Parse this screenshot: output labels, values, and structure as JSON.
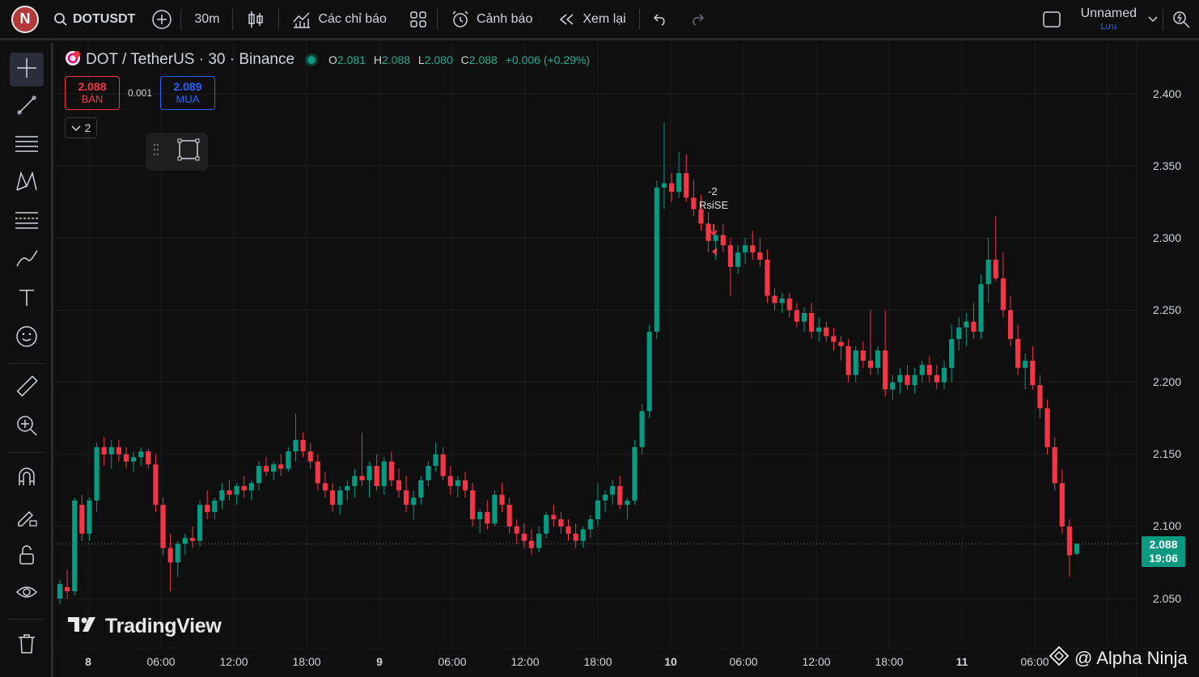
{
  "toolbar": {
    "avatar": "N",
    "symbol": "DOTUSDT",
    "interval": "30m",
    "indicators": "Các chỉ báo",
    "alerts": "Cảnh báo",
    "replay": "Xem lại",
    "layout_name": "Unnamed",
    "save": "Lưu"
  },
  "legend": {
    "title": "DOT / TetherUS · 30 · Binance",
    "o_key": "O",
    "o": "2.081",
    "h_key": "H",
    "h": "2.088",
    "l_key": "L",
    "l": "2.080",
    "c_key": "C",
    "c": "2.088",
    "change": "+0.006 (+0.29%)"
  },
  "trade": {
    "sell_price": "2.088",
    "sell_label": "BÁN",
    "spread": "0.001",
    "buy_price": "2.089",
    "buy_label": "MUA",
    "collapse_count": "2"
  },
  "price_axis": [
    "2.400",
    "2.350",
    "2.300",
    "2.250",
    "2.200",
    "2.150",
    "2.100",
    "2.050"
  ],
  "time_axis": [
    "8",
    "06:00",
    "12:00",
    "18:00",
    "9",
    "06:00",
    "12:00",
    "18:00",
    "10",
    "06:00",
    "12:00",
    "18:00",
    "11",
    "06:00"
  ],
  "last_price": {
    "price": "2.088",
    "countdown": "19:06"
  },
  "annotation": {
    "qty": "-2",
    "label": "RsiSE"
  },
  "brand": "TradingView",
  "watermark": "@ Alpha Ninja",
  "colors": {
    "up": "#089981",
    "down": "#f23645",
    "background": "#0f0f0f",
    "accent": "#2962ff"
  },
  "chart_data": {
    "type": "candlestick",
    "symbol": "DOT / TetherUS",
    "interval": "30",
    "exchange": "Binance",
    "ylim": [
      2.05,
      2.4
    ],
    "candles": [
      [
        2.05,
        2.063,
        2.046,
        2.06
      ],
      [
        2.058,
        2.07,
        2.05,
        2.055
      ],
      [
        2.055,
        2.12,
        2.052,
        2.118
      ],
      [
        2.115,
        2.122,
        2.09,
        2.095
      ],
      [
        2.095,
        2.12,
        2.09,
        2.118
      ],
      [
        2.118,
        2.158,
        2.11,
        2.155
      ],
      [
        2.155,
        2.162,
        2.142,
        2.15
      ],
      [
        2.15,
        2.16,
        2.14,
        2.155
      ],
      [
        2.155,
        2.16,
        2.145,
        2.15
      ],
      [
        2.15,
        2.155,
        2.14,
        2.145
      ],
      [
        2.145,
        2.152,
        2.138,
        2.148
      ],
      [
        2.148,
        2.155,
        2.142,
        2.152
      ],
      [
        2.152,
        2.154,
        2.14,
        2.143
      ],
      [
        2.143,
        2.15,
        2.11,
        2.115
      ],
      [
        2.115,
        2.12,
        2.08,
        2.085
      ],
      [
        2.085,
        2.095,
        2.055,
        2.075
      ],
      [
        2.075,
        2.09,
        2.065,
        2.088
      ],
      [
        2.088,
        2.095,
        2.08,
        2.092
      ],
      [
        2.092,
        2.1,
        2.085,
        2.09
      ],
      [
        2.09,
        2.118,
        2.086,
        2.115
      ],
      [
        2.115,
        2.125,
        2.105,
        2.11
      ],
      [
        2.11,
        2.12,
        2.105,
        2.118
      ],
      [
        2.118,
        2.13,
        2.112,
        2.125
      ],
      [
        2.125,
        2.132,
        2.118,
        2.122
      ],
      [
        2.122,
        2.13,
        2.115,
        2.128
      ],
      [
        2.128,
        2.135,
        2.12,
        2.125
      ],
      [
        2.125,
        2.132,
        2.118,
        2.13
      ],
      [
        2.13,
        2.145,
        2.125,
        2.142
      ],
      [
        2.142,
        2.148,
        2.135,
        2.138
      ],
      [
        2.138,
        2.145,
        2.132,
        2.143
      ],
      [
        2.143,
        2.15,
        2.135,
        2.14
      ],
      [
        2.14,
        2.155,
        2.138,
        2.152
      ],
      [
        2.152,
        2.178,
        2.145,
        2.16
      ],
      [
        2.16,
        2.165,
        2.148,
        2.152
      ],
      [
        2.152,
        2.158,
        2.14,
        2.145
      ],
      [
        2.145,
        2.15,
        2.125,
        2.13
      ],
      [
        2.13,
        2.138,
        2.12,
        2.125
      ],
      [
        2.125,
        2.13,
        2.11,
        2.115
      ],
      [
        2.115,
        2.128,
        2.108,
        2.125
      ],
      [
        2.125,
        2.132,
        2.118,
        2.128
      ],
      [
        2.128,
        2.14,
        2.12,
        2.135
      ],
      [
        2.135,
        2.165,
        2.128,
        2.132
      ],
      [
        2.132,
        2.145,
        2.12,
        2.142
      ],
      [
        2.142,
        2.15,
        2.125,
        2.128
      ],
      [
        2.128,
        2.148,
        2.122,
        2.145
      ],
      [
        2.145,
        2.152,
        2.128,
        2.132
      ],
      [
        2.132,
        2.14,
        2.12,
        2.125
      ],
      [
        2.125,
        2.135,
        2.11,
        2.115
      ],
      [
        2.115,
        2.125,
        2.105,
        2.12
      ],
      [
        2.12,
        2.135,
        2.115,
        2.132
      ],
      [
        2.132,
        2.145,
        2.128,
        2.142
      ],
      [
        2.142,
        2.158,
        2.138,
        2.15
      ],
      [
        2.15,
        2.155,
        2.132,
        2.135
      ],
      [
        2.135,
        2.142,
        2.122,
        2.128
      ],
      [
        2.128,
        2.135,
        2.12,
        2.132
      ],
      [
        2.132,
        2.138,
        2.12,
        2.125
      ],
      [
        2.125,
        2.13,
        2.1,
        2.105
      ],
      [
        2.105,
        2.112,
        2.095,
        2.11
      ],
      [
        2.11,
        2.118,
        2.098,
        2.102
      ],
      [
        2.102,
        2.125,
        2.1,
        2.122
      ],
      [
        2.122,
        2.13,
        2.11,
        2.115
      ],
      [
        2.115,
        2.12,
        2.095,
        2.1
      ],
      [
        2.1,
        2.105,
        2.088,
        2.095
      ],
      [
        2.095,
        2.102,
        2.085,
        2.09
      ],
      [
        2.09,
        2.098,
        2.08,
        2.085
      ],
      [
        2.085,
        2.1,
        2.082,
        2.095
      ],
      [
        2.095,
        2.11,
        2.092,
        2.108
      ],
      [
        2.108,
        2.115,
        2.1,
        2.105
      ],
      [
        2.105,
        2.11,
        2.095,
        2.1
      ],
      [
        2.1,
        2.105,
        2.09,
        2.095
      ],
      [
        2.095,
        2.102,
        2.085,
        2.09
      ],
      [
        2.09,
        2.1,
        2.085,
        2.098
      ],
      [
        2.098,
        2.108,
        2.092,
        2.105
      ],
      [
        2.105,
        2.13,
        2.1,
        2.118
      ],
      [
        2.118,
        2.125,
        2.11,
        2.122
      ],
      [
        2.122,
        2.132,
        2.115,
        2.128
      ],
      [
        2.128,
        2.135,
        2.112,
        2.115
      ],
      [
        2.115,
        2.12,
        2.105,
        2.118
      ],
      [
        2.118,
        2.16,
        2.115,
        2.155
      ],
      [
        2.155,
        2.185,
        2.15,
        2.18
      ],
      [
        2.18,
        2.24,
        2.175,
        2.235
      ],
      [
        2.235,
        2.34,
        2.23,
        2.335
      ],
      [
        2.335,
        2.38,
        2.32,
        2.338
      ],
      [
        2.338,
        2.345,
        2.325,
        2.332
      ],
      [
        2.332,
        2.36,
        2.328,
        2.345
      ],
      [
        2.345,
        2.358,
        2.325,
        2.328
      ],
      [
        2.328,
        2.34,
        2.315,
        2.32
      ],
      [
        2.32,
        2.33,
        2.305,
        2.31
      ],
      [
        2.31,
        2.318,
        2.29,
        2.298
      ],
      [
        2.298,
        2.305,
        2.285,
        2.302
      ],
      [
        2.302,
        2.31,
        2.29,
        2.295
      ],
      [
        2.295,
        2.3,
        2.26,
        2.28
      ],
      [
        2.28,
        2.295,
        2.275,
        2.29
      ],
      [
        2.29,
        2.3,
        2.282,
        2.295
      ],
      [
        2.295,
        2.305,
        2.285,
        2.29
      ],
      [
        2.29,
        2.3,
        2.28,
        2.285
      ],
      [
        2.285,
        2.292,
        2.255,
        2.26
      ],
      [
        2.26,
        2.265,
        2.25,
        2.255
      ],
      [
        2.255,
        2.262,
        2.248,
        2.258
      ],
      [
        2.258,
        2.262,
        2.245,
        2.25
      ],
      [
        2.25,
        2.255,
        2.238,
        2.242
      ],
      [
        2.242,
        2.252,
        2.235,
        2.248
      ],
      [
        2.248,
        2.255,
        2.23,
        2.235
      ],
      [
        2.235,
        2.245,
        2.228,
        2.238
      ],
      [
        2.238,
        2.242,
        2.228,
        2.232
      ],
      [
        2.232,
        2.238,
        2.222,
        2.228
      ],
      [
        2.228,
        2.232,
        2.215,
        2.225
      ],
      [
        2.225,
        2.23,
        2.2,
        2.205
      ],
      [
        2.205,
        2.225,
        2.2,
        2.222
      ],
      [
        2.222,
        2.228,
        2.21,
        2.215
      ],
      [
        2.215,
        2.25,
        2.205,
        2.21
      ],
      [
        2.21,
        2.225,
        2.205,
        2.222
      ],
      [
        2.222,
        2.25,
        2.19,
        2.195
      ],
      [
        2.195,
        2.205,
        2.188,
        2.2
      ],
      [
        2.2,
        2.21,
        2.192,
        2.205
      ],
      [
        2.205,
        2.212,
        2.195,
        2.198
      ],
      [
        2.198,
        2.21,
        2.192,
        2.205
      ],
      [
        2.205,
        2.215,
        2.2,
        2.212
      ],
      [
        2.212,
        2.218,
        2.2,
        2.205
      ],
      [
        2.205,
        2.212,
        2.195,
        2.2
      ],
      [
        2.2,
        2.215,
        2.195,
        2.21
      ],
      [
        2.21,
        2.24,
        2.2,
        2.23
      ],
      [
        2.23,
        2.245,
        2.222,
        2.238
      ],
      [
        2.238,
        2.248,
        2.225,
        2.242
      ],
      [
        2.242,
        2.255,
        2.23,
        2.235
      ],
      [
        2.235,
        2.275,
        2.23,
        2.268
      ],
      [
        2.268,
        2.3,
        2.255,
        2.285
      ],
      [
        2.285,
        2.315,
        2.27,
        2.272
      ],
      [
        2.272,
        2.29,
        2.245,
        2.25
      ],
      [
        2.25,
        2.26,
        2.225,
        2.23
      ],
      [
        2.23,
        2.24,
        2.205,
        2.21
      ],
      [
        2.21,
        2.22,
        2.195,
        2.215
      ],
      [
        2.215,
        2.225,
        2.195,
        2.198
      ],
      [
        2.198,
        2.205,
        2.175,
        2.182
      ],
      [
        2.182,
        2.188,
        2.15,
        2.155
      ],
      [
        2.155,
        2.162,
        2.125,
        2.13
      ],
      [
        2.13,
        2.14,
        2.095,
        2.1
      ],
      [
        2.1,
        2.105,
        2.065,
        2.08
      ],
      [
        2.081,
        2.088,
        2.08,
        2.088
      ]
    ]
  }
}
